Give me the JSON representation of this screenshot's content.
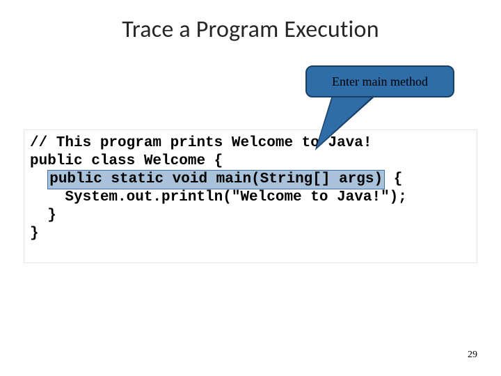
{
  "title": "Trace a Program Execution",
  "callout": {
    "label": "Enter main method"
  },
  "code": {
    "line1": "// This program prints Welcome to Java! ",
    "line2": "public class Welcome {",
    "line3_prefix": "  ",
    "line3_highlight": "public static void main(String[] args)",
    "line3_suffix": " { ",
    "line4": "    System.out.println(\"Welcome to Java!\");",
    "line5": "  }",
    "line6": "}"
  },
  "page_number": "29"
}
